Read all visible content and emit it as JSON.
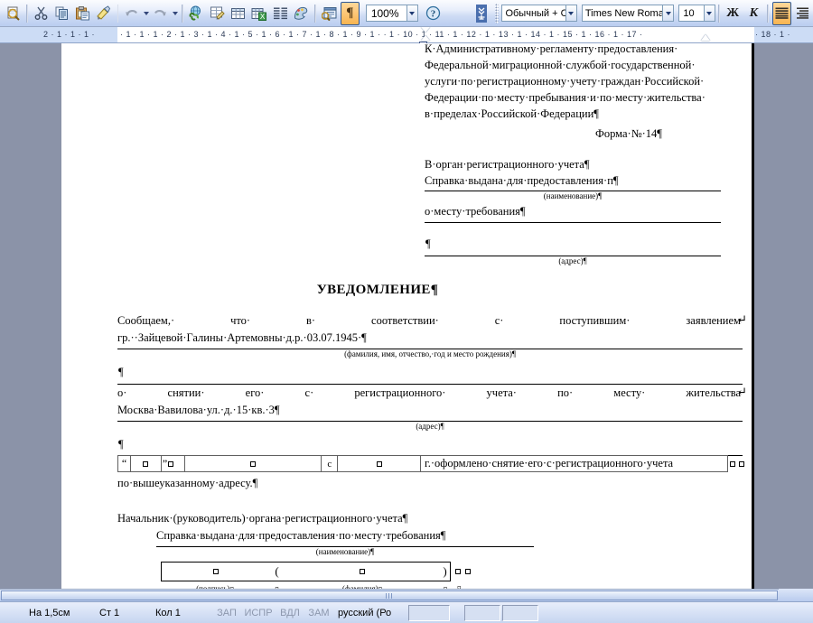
{
  "toolbar": {
    "buttons": [
      {
        "name": "print-preview-icon",
        "label": "Предварительный просмотр"
      },
      {
        "name": "cut-icon",
        "label": "Вырезать"
      },
      {
        "name": "copy-icon",
        "label": "Копировать"
      },
      {
        "name": "paste-icon",
        "label": "Вставить"
      },
      {
        "name": "format-painter-icon",
        "label": "Формат по образцу"
      },
      {
        "name": "undo-icon",
        "label": "Отменить"
      },
      {
        "name": "redo-icon",
        "label": "Вернуть"
      },
      {
        "name": "hyperlink-icon",
        "label": "Добавить гиперссылку"
      },
      {
        "name": "tables-and-borders-icon",
        "label": "Таблицы и границы"
      },
      {
        "name": "insert-table-icon",
        "label": "Добавить таблицу"
      },
      {
        "name": "insert-excel-sheet-icon",
        "label": "Добавить лист Microsoft Excel"
      },
      {
        "name": "columns-icon",
        "label": "Колонки"
      },
      {
        "name": "drawing-icon",
        "label": "Рисование"
      },
      {
        "name": "document-map-icon",
        "label": "Схема документа"
      },
      {
        "name": "show-formatting-marks-icon",
        "label": "Непечатаемые знаки"
      }
    ],
    "zoom": "100%",
    "help_label": "Справка",
    "style": "Обычный + Сле",
    "font": "Times New Roman",
    "size": "10",
    "bold_label": "Ж",
    "italic_label": "К",
    "align_label": "Выровнять по ширине"
  },
  "ruler": {
    "left_marks": "2 · 1 · 1 · 1 ·",
    "marks": "· 1 · 1 · 1 · 2 · 1 · 3 · 1 · 4 · 1 · 5 · 1 · 6 · 1 · 7 · 1 · 8 · 1 · 9 · 1 ·      · 1 · 10 · 1 · 11 · 1 · 12 · 1 · 13 · 1 · 14 · 1 · 15 · 1 · 16 · 1 · 17 · ",
    "right_marks": "· 18 · 1 ·"
  },
  "document": {
    "header_paragraph": [
      "К·Административному·регламенту·предоставления·",
      "Федеральной·миграционной·службой·государственной·",
      "услуги·по·регистрационному·учету·граждан·Российской·",
      "Федерации·по·месту·пребывания·и·по·месту·жительства·",
      "в·пределах·Российской·Федерации¶"
    ],
    "form_number": "Форма·№·14¶",
    "to_authority": "В·орган·регистрационного·учета¶",
    "certificate_line1": "Справка·выдана·для·предоставления·п¶",
    "caption_name_1": "(наименование)¶",
    "certificate_line2": "о·месту·требования¶",
    "empty_para_1": "¶",
    "caption_address_1": "(адрес)¶",
    "title": "УВЕДОМЛЕНИЕ¶",
    "body_words_1": [
      "Сообщаем,·",
      "что·",
      "в·",
      "соответствии·",
      "с·",
      "поступившим·",
      "заявлением"
    ],
    "wrap_mark": "↵",
    "citizen_line": "гр.··Зайцевой·Галины·Артемовны·д.р.·03.07.1945·¶",
    "caption_fio": "(фамилия, имя, отчество,·год и место рождения)¶",
    "empty_para_2": "¶",
    "body_words_2": [
      "о·",
      "снятии·",
      "его·",
      "с·",
      "регистрационного·",
      "учета·",
      "по·",
      "месту·",
      "жительства"
    ],
    "address_line": "Москва·Вавилова·ул.·д.·15·кв.·3¶",
    "caption_address_2": "(адрес)¶",
    "empty_para_3": "¶",
    "date_table": {
      "prefix_quote": "“",
      "cells": [
        " ",
        "”",
        " ",
        "с",
        " "
      ],
      "suffix": "г.·оформлено·снятие·его·с·регистрационного·учета"
    },
    "after_table_line": "по·вышеуказанному·адресу.¶",
    "chief_line": "Начальник·(руководитель)·органа·регистрационного·учета¶",
    "certificate_line3": "Справка·выдана·для·предоставления·по·месту·требования¶",
    "caption_name_2": "(наименование)¶",
    "sign_caption": "(подпись)",
    "surname_caption": "(фамилия)",
    "open_paren": "(",
    "close_paren": ")"
  },
  "statusbar": {
    "position": "На  1,5см",
    "line": "Ст  1",
    "column": "Кол  1",
    "rec": "ЗАП",
    "trk": "ИСПР",
    "ext": "ВДЛ",
    "ovr": "ЗАМ",
    "language": "русский (Ро"
  }
}
